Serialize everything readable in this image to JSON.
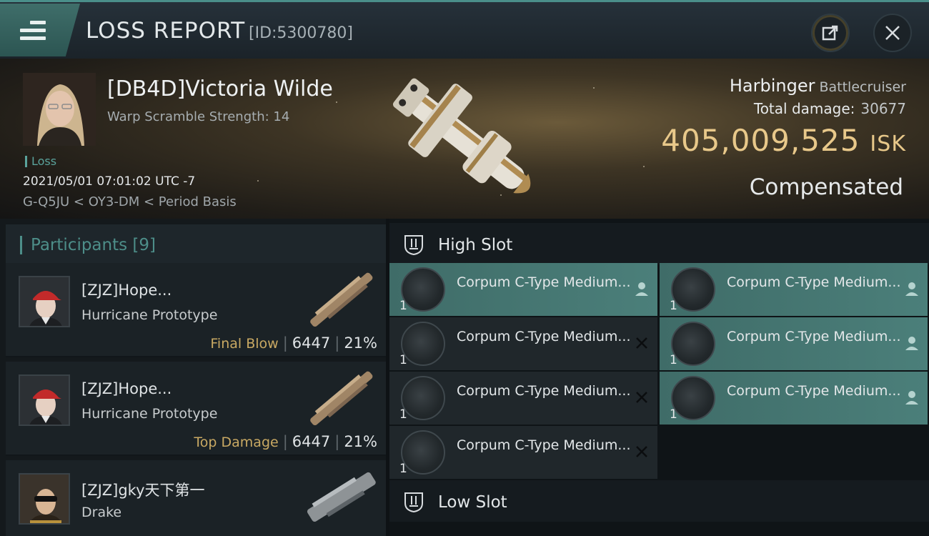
{
  "titlebar": {
    "title": "LOSS REPORT",
    "report_id": "[ID:5300780]",
    "icons": [
      "menu-icon",
      "share-icon",
      "close-icon"
    ]
  },
  "victim": {
    "name": "[DB4D]Victoria Wilde",
    "warp_scramble": "Warp Scramble Strength: 14",
    "loss_label": "Loss",
    "datetime": "2021/05/01 07:01:02 UTC -7",
    "location": "G-Q5JU < OY3-DM < Period Basis",
    "ship_name": "Harbinger",
    "ship_class": "Battlecruiser",
    "total_damage_label": "Total damage:",
    "total_damage": "30677",
    "isk_value": "405,009,525",
    "isk_unit": "ISK",
    "status": "Compensated"
  },
  "participants": {
    "header": "Participants [9]",
    "rows": [
      {
        "name": "[ZJZ]Hope...",
        "ship": "Hurricane Prototype",
        "tag": "Final Blow",
        "damage": "6447",
        "percent": "21%"
      },
      {
        "name": "[ZJZ]Hope...",
        "ship": "Hurricane Prototype",
        "tag": "Top Damage",
        "damage": "6447",
        "percent": "21%"
      },
      {
        "name": "[ZJZ]gky天下第一",
        "ship": "Drake",
        "tag": "",
        "damage": "",
        "percent": ""
      }
    ]
  },
  "fitting": {
    "high_slot_label": "High Slot",
    "low_slot_label": "Low Slot",
    "high_modules": [
      {
        "name": "Corpum C-Type Medium...",
        "qty": "1",
        "status": "dropped",
        "status_icon": "person-icon"
      },
      {
        "name": "Corpum C-Type Medium...",
        "qty": "1",
        "status": "dropped",
        "status_icon": "person-icon"
      },
      {
        "name": "Corpum C-Type Medium...",
        "qty": "1",
        "status": "destroyed",
        "status_icon": "x-icon"
      },
      {
        "name": "Corpum C-Type Medium...",
        "qty": "1",
        "status": "dropped",
        "status_icon": "person-icon"
      },
      {
        "name": "Corpum C-Type Medium...",
        "qty": "1",
        "status": "destroyed",
        "status_icon": "x-icon"
      },
      {
        "name": "Corpum C-Type Medium...",
        "qty": "1",
        "status": "dropped",
        "status_icon": "person-icon"
      },
      {
        "name": "Corpum C-Type Medium...",
        "qty": "1",
        "status": "destroyed",
        "status_icon": "x-icon"
      }
    ]
  },
  "colors": {
    "accent_teal": "#4d8e89",
    "isk_gold": "#e8c88a",
    "tag_gold": "#c9a963"
  }
}
